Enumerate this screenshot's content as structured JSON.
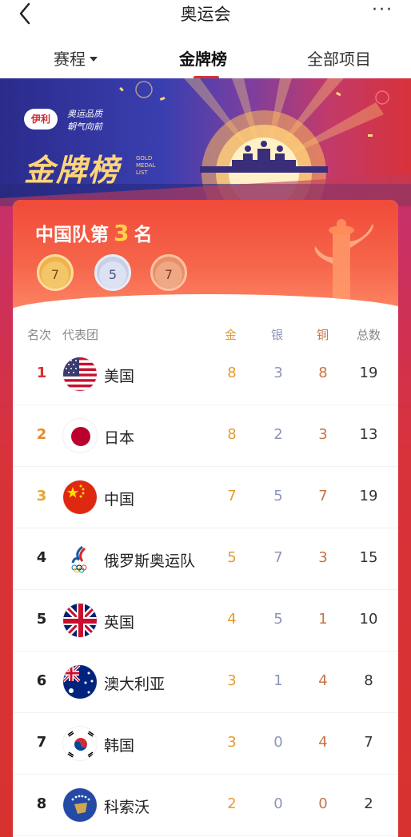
{
  "header": {
    "title": "奥运会",
    "more_label": "···"
  },
  "tabs": [
    {
      "label": "赛程"
    },
    {
      "label": "金牌榜"
    },
    {
      "label": "全部项目"
    }
  ],
  "banner": {
    "brand": "伊利",
    "brand_line1": "奥运品质",
    "brand_line2": "朝气向前",
    "title": "金牌榜",
    "subtitle": "GOLD MEDAL LIST"
  },
  "summary": {
    "prefix": "中国队第",
    "rank": "3",
    "suffix": "名",
    "gold": "7",
    "silver": "5",
    "bronze": "7"
  },
  "table": {
    "headers": {
      "rank": "名次",
      "team": "代表团",
      "gold": "金",
      "silver": "银",
      "bronze": "铜",
      "total": "总数"
    },
    "rows": [
      {
        "rank": "1",
        "name": "美国",
        "flag": "usa-flag-icon",
        "gold": "8",
        "silver": "3",
        "bronze": "8",
        "total": "19"
      },
      {
        "rank": "2",
        "name": "日本",
        "flag": "japan-flag-icon",
        "gold": "8",
        "silver": "2",
        "bronze": "3",
        "total": "13"
      },
      {
        "rank": "3",
        "name": "中国",
        "flag": "china-flag-icon",
        "gold": "7",
        "silver": "5",
        "bronze": "7",
        "total": "19"
      },
      {
        "rank": "4",
        "name": "俄罗斯奥运队",
        "flag": "roc-emblem-icon",
        "gold": "5",
        "silver": "7",
        "bronze": "3",
        "total": "15"
      },
      {
        "rank": "5",
        "name": "英国",
        "flag": "uk-flag-icon",
        "gold": "4",
        "silver": "5",
        "bronze": "1",
        "total": "10"
      },
      {
        "rank": "6",
        "name": "澳大利亚",
        "flag": "australia-flag-icon",
        "gold": "3",
        "silver": "1",
        "bronze": "4",
        "total": "8"
      },
      {
        "rank": "7",
        "name": "韩国",
        "flag": "korea-flag-icon",
        "gold": "3",
        "silver": "0",
        "bronze": "4",
        "total": "7"
      },
      {
        "rank": "8",
        "name": "科索沃",
        "flag": "kosovo-flag-icon",
        "gold": "2",
        "silver": "0",
        "bronze": "0",
        "total": "2"
      }
    ]
  },
  "colors": {
    "accent_red": "#d8322f",
    "gold": "#e69a33",
    "silver": "#8d95b8",
    "bronze": "#c87345",
    "rank1": "#d8322f",
    "rank2": "#e68a2e",
    "rank3": "#e6a52e"
  }
}
